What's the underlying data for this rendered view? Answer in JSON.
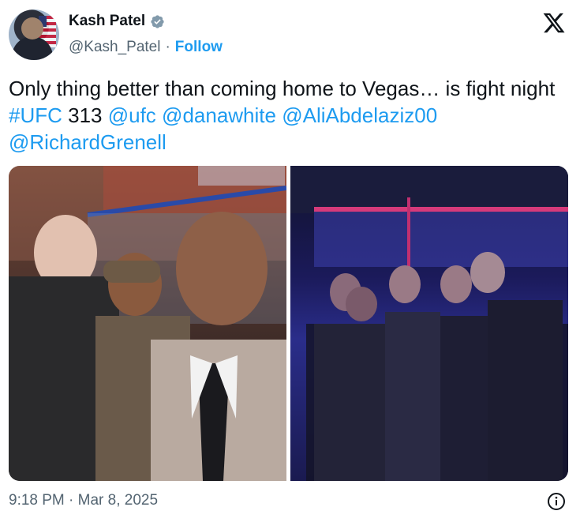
{
  "author": {
    "name": "Kash Patel",
    "handle": "@Kash_Patel",
    "separator": "·",
    "follow_label": "Follow"
  },
  "post": {
    "text_parts": [
      {
        "text": "Only thing better than coming home to Vegas… is fight night ",
        "link": false
      },
      {
        "text": "#UFC",
        "link": true
      },
      {
        "text": " 313 ",
        "link": false
      },
      {
        "text": "@ufc",
        "link": true
      },
      {
        "text": " ",
        "link": false
      },
      {
        "text": "@danawhite",
        "link": true
      },
      {
        "text": " ",
        "link": false
      },
      {
        "text": "@AliAbdelaziz00",
        "link": true
      },
      {
        "text": " ",
        "link": false
      },
      {
        "text": "@RichardGrenell",
        "link": true
      }
    ],
    "timestamp": "9:18 PM · Mar 8, 2025"
  },
  "icons": {
    "verified": "verified-badge-icon",
    "platform": "x-logo-icon",
    "info": "info-icon"
  },
  "colors": {
    "link": "#1d9bf0",
    "secondary_text": "#536471",
    "primary_text": "#0f1419"
  }
}
